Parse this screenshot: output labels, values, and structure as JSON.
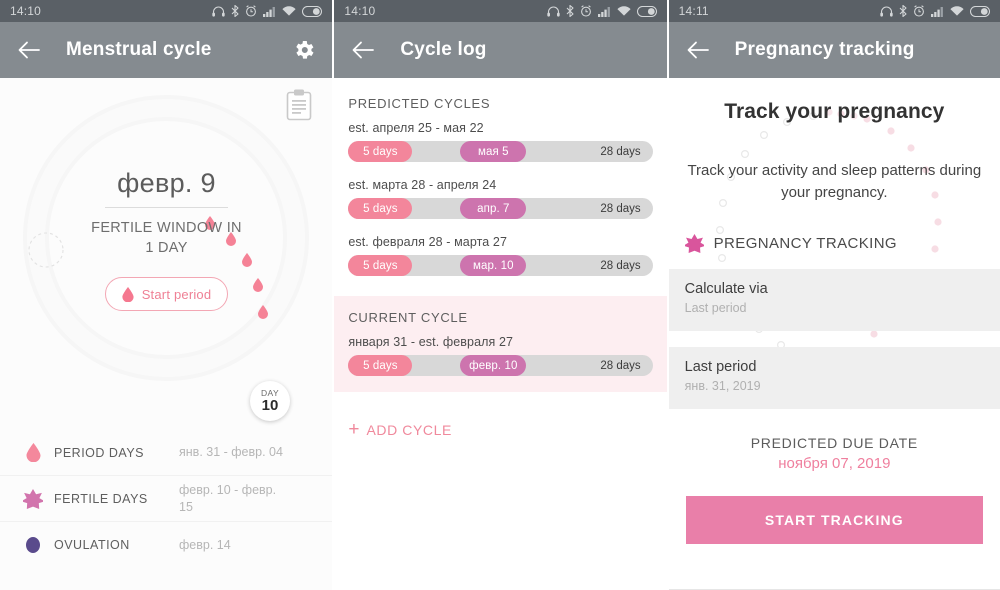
{
  "panels": [
    {
      "statusbar": {
        "time": "14:10",
        "icons": [
          "headphones-icon",
          "bluetooth-icon",
          "alarm-icon",
          "signal-icon",
          "wifi-icon",
          "battery-icon"
        ]
      },
      "appbar": {
        "title": "Menstrual cycle",
        "back_icon": "back-arrow-icon",
        "action_icon": "gear-icon"
      },
      "notes_icon": "clipboard-icon",
      "ring": {
        "date": "февр. 9",
        "status_line1": "FERTILE WINDOW IN",
        "status_line2": "1 DAY",
        "button_label": "Start period",
        "day_badge_label": "DAY",
        "day_badge_value": "10"
      },
      "legend": [
        {
          "icon": "drop-icon",
          "label": "PERIOD DAYS",
          "value": "янв. 31 - февр. 04",
          "color": "#f4889c"
        },
        {
          "icon": "flower-icon",
          "label": "FERTILE DAYS",
          "value": "февр. 10 - февр. 15",
          "color": "#d274ad"
        },
        {
          "icon": "ovulation-icon",
          "label": "OVULATION",
          "value": "февр. 14",
          "color": "#5a4b8c"
        }
      ]
    },
    {
      "statusbar": {
        "time": "14:10",
        "icons": [
          "headphones-icon",
          "bluetooth-icon",
          "alarm-icon",
          "signal-icon",
          "wifi-icon",
          "battery-icon"
        ]
      },
      "appbar": {
        "title": "Cycle log",
        "back_icon": "back-arrow-icon"
      },
      "predicted_title": "PREDICTED CYCLES",
      "predicted_cycles": [
        {
          "range": "est. апреля 25 - мая 22",
          "period_days": "5 days",
          "ovulation": "мая 5",
          "total": "28 days"
        },
        {
          "range": "est. марта 28 - апреля 24",
          "period_days": "5 days",
          "ovulation": "апр. 7",
          "total": "28 days"
        },
        {
          "range": "est. февраля 28 - марта 27",
          "period_days": "5 days",
          "ovulation": "мар. 10",
          "total": "28 days"
        }
      ],
      "current_title": "CURRENT CYCLE",
      "current_cycle": {
        "range": "января 31 - est. февраля 27",
        "period_days": "5 days",
        "ovulation": "февр. 10",
        "total": "28 days"
      },
      "add_cycle": {
        "plus": "+",
        "label": "ADD CYCLE"
      }
    },
    {
      "statusbar": {
        "time": "14:11",
        "icons": [
          "headphones-icon",
          "bluetooth-icon",
          "alarm-icon",
          "signal-icon",
          "wifi-icon",
          "battery-icon"
        ]
      },
      "appbar": {
        "title": "Pregnancy tracking",
        "back_icon": "back-arrow-icon"
      },
      "headline": "Track your pregnancy",
      "subtext": "Track your activity and sleep patterns during your pregnancy.",
      "tag_icon": "flower-icon",
      "tag_label": "PREGNANCY TRACKING",
      "fields": [
        {
          "label": "Calculate via",
          "value": "Last period"
        },
        {
          "label": "Last period",
          "value": "янв. 31, 2019"
        }
      ],
      "due_label": "PREDICTED DUE DATE",
      "due_value": "ноября 07, 2019",
      "cta_label": "START TRACKING"
    }
  ],
  "colors": {
    "statusbar_bg": "#5a6066",
    "appbar_bg": "#858b90",
    "accent_pink": "#ef8095",
    "cta_pink": "#e97fa9",
    "ovulation_purple": "#cd74ae",
    "current_bg": "#fdeef1"
  }
}
